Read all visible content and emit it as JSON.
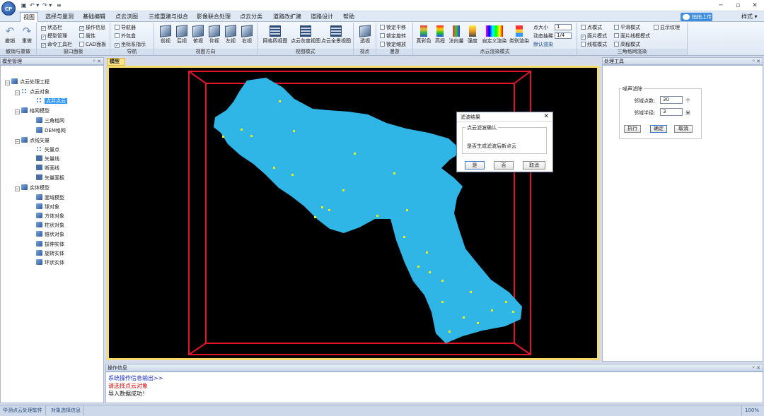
{
  "titlebar": {
    "app_logo": "CP",
    "qat_items": [
      "▣",
      "↶ ▾",
      "↷ ▾",
      "≡"
    ],
    "minimize": "─",
    "maximize": "▫",
    "close": "✕"
  },
  "menu": {
    "tabs": [
      "视图",
      "选择与量测",
      "基础编辑",
      "点云浏图",
      "三维重建与拟合",
      "影像联合处理",
      "点云分类",
      "道路改扩建",
      "道路设计",
      "帮助"
    ],
    "help_button": "拍拍上传",
    "style_menu": "样式 ▾"
  },
  "ribbon": {
    "undo": "撤销",
    "redo": "重做",
    "undo_group": "撤销与重做",
    "window_panel": {
      "label": "窗口面板",
      "checks": [
        {
          "label": "状态栏",
          "on": true
        },
        {
          "label": "操作信息",
          "on": true
        },
        {
          "label": "模型管理",
          "on": true
        },
        {
          "label": "属性",
          "on": false
        },
        {
          "label": "命令工具栏",
          "on": true
        },
        {
          "label": "CAD面板",
          "on": false
        }
      ]
    },
    "nav": {
      "label": "导航",
      "checks": [
        {
          "label": "导航器",
          "on": false
        },
        {
          "label": "外包盒",
          "on": false
        },
        {
          "label": "坐标系指示",
          "on": true
        }
      ]
    },
    "view_dir": {
      "label": "视图方向",
      "buttons": [
        "前视",
        "后视",
        "俯视",
        "仰视",
        "左视",
        "右视"
      ]
    },
    "view_mode": {
      "label": "视图模式",
      "buttons": [
        "网格四视图",
        "点云灰度视图",
        "点云全景视图"
      ]
    },
    "view_point": {
      "label": "视点",
      "button": "透视"
    },
    "roam": {
      "label": "漫游",
      "checks": [
        {
          "label": "锁定平移",
          "on": false
        },
        {
          "label": "锁定旋转",
          "on": false
        },
        {
          "label": "锁定缩放",
          "on": false
        }
      ]
    },
    "pc_render": {
      "label": "点云渲染模式",
      "buttons": [
        "真彩色",
        "高程",
        "法向量",
        "强度",
        "自定义渲染",
        "类别渲染"
      ],
      "point_size_label": "点大小",
      "point_size": "1",
      "dyn_label": "动态抽稀",
      "dyn_value": "1/4",
      "default_render": "默认渲染"
    },
    "mesh_render": {
      "label": "三角格网渲染",
      "checks": [
        {
          "label": "点模式",
          "on": false
        },
        {
          "label": "平滑模式",
          "on": false
        },
        {
          "label": "显示纹理",
          "on": false
        },
        {
          "label": "面片模式",
          "on": true
        },
        {
          "label": "面片线框模式",
          "on": false
        },
        {
          "label": "线框模式",
          "on": false
        },
        {
          "label": "高程模式",
          "on": false
        }
      ]
    }
  },
  "left_panel": {
    "title": "模型管理",
    "pin": "ᵖ ✕",
    "tree": {
      "root": "点云处理工程",
      "pointcloud_obj": "点云对象",
      "selected": "点井点云",
      "mesh_model": "格网模型",
      "tin": "三角格网",
      "dem": "DEM格网",
      "vector": "点线矢量",
      "vec_point": "矢量点",
      "vec_line": "矢量线",
      "break_line": "断面线",
      "vec_surface": "矢量面板",
      "solid": "实体模型",
      "model_import": "面域模型",
      "sphere": "球对象",
      "box": "方体对象",
      "cylinder": "柱状对象",
      "cone": "锥状对象",
      "extrude": "拔伸实体",
      "revolve": "旋转实体",
      "annulus": "环状实体"
    }
  },
  "viewport": {
    "tab": "模型",
    "cloud_color": "#2fb6e6",
    "box_color": "#e0142a",
    "marker_color": "#ecec1a"
  },
  "dialog": {
    "title": "滤波结果",
    "group_title": "点云滤波确认",
    "message": "是否生成滤波后新点云",
    "yes": "是",
    "no": "否",
    "cancel": "取消"
  },
  "right_panel": {
    "title": "处理工具",
    "pin": "ᵖ ✕",
    "group_title": "噪声滤除",
    "neighbor_count_label": "邻域点数:",
    "neighbor_count": "30",
    "neighbor_count_unit": "个",
    "neighbor_radius_label": "邻域半径:",
    "neighbor_radius": "3",
    "neighbor_radius_unit": "米",
    "execute": "执行",
    "confirm": "确定",
    "cancel": "取消"
  },
  "log_panel": {
    "title": "操作信息",
    "pin": "ᵖ ✕",
    "lines": [
      {
        "text": "系统操作信息输出>>",
        "color": "#1a2fd0"
      },
      {
        "text": "请选择点云对象",
        "color": "#e01010"
      },
      {
        "text": "导入数据成功！",
        "color": "#111111"
      }
    ]
  },
  "status": {
    "left1": "华测点云处理软件",
    "left2": "对象选择信息",
    "zoom": "100%"
  }
}
